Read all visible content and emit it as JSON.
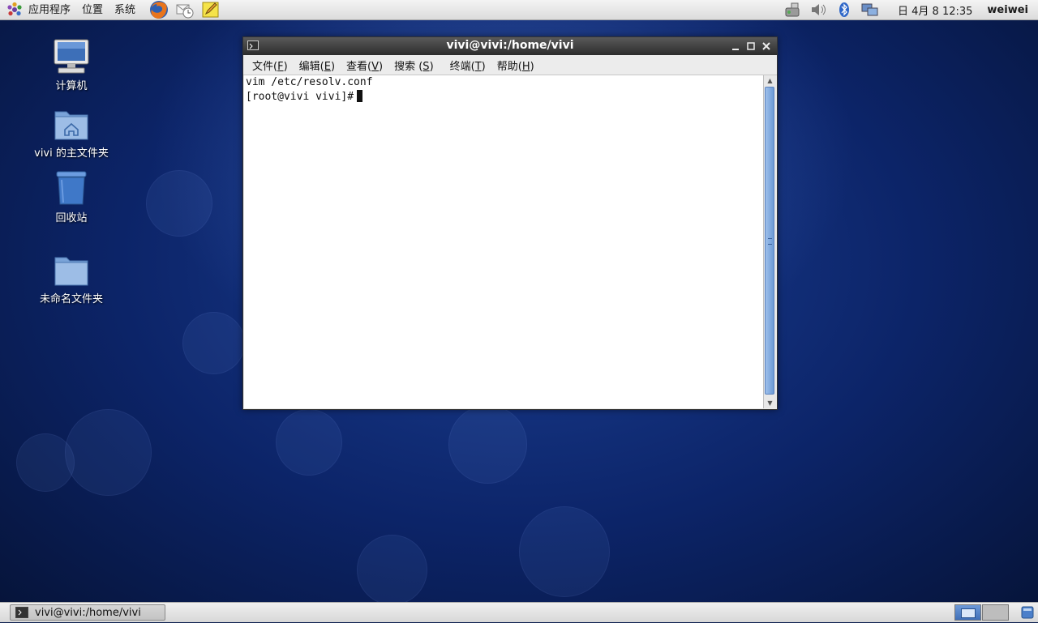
{
  "top_panel": {
    "menus": [
      "应用程序",
      "位置",
      "系统"
    ],
    "clock": "日 4月  8 12:35",
    "username": "weiwei"
  },
  "desktop_icons": [
    {
      "label": "计算机"
    },
    {
      "label": "vivi 的主文件夹"
    },
    {
      "label": "回收站"
    },
    {
      "label": "未命名文件夹"
    }
  ],
  "terminal": {
    "title": "vivi@vivi:/home/vivi",
    "menu": [
      {
        "text": "文件(",
        "key": "F",
        "end": ")"
      },
      {
        "text": "编辑(",
        "key": "E",
        "end": ")"
      },
      {
        "text": "查看(",
        "key": "V",
        "end": ")"
      },
      {
        "text": "搜索 (",
        "key": "S",
        "end": ")"
      },
      {
        "text": "终端(",
        "key": "T",
        "end": ")"
      },
      {
        "text": "帮助(",
        "key": "H",
        "end": ")"
      }
    ],
    "lines": [
      "vim /etc/resolv.conf",
      "[root@vivi vivi]#"
    ]
  },
  "taskbar": {
    "window_label": "vivi@vivi:/home/vivi"
  },
  "colors": {
    "desktop": "#0c2468",
    "titlebar": "#2c2c2c",
    "scroll_thumb": "#6c9ad6"
  }
}
